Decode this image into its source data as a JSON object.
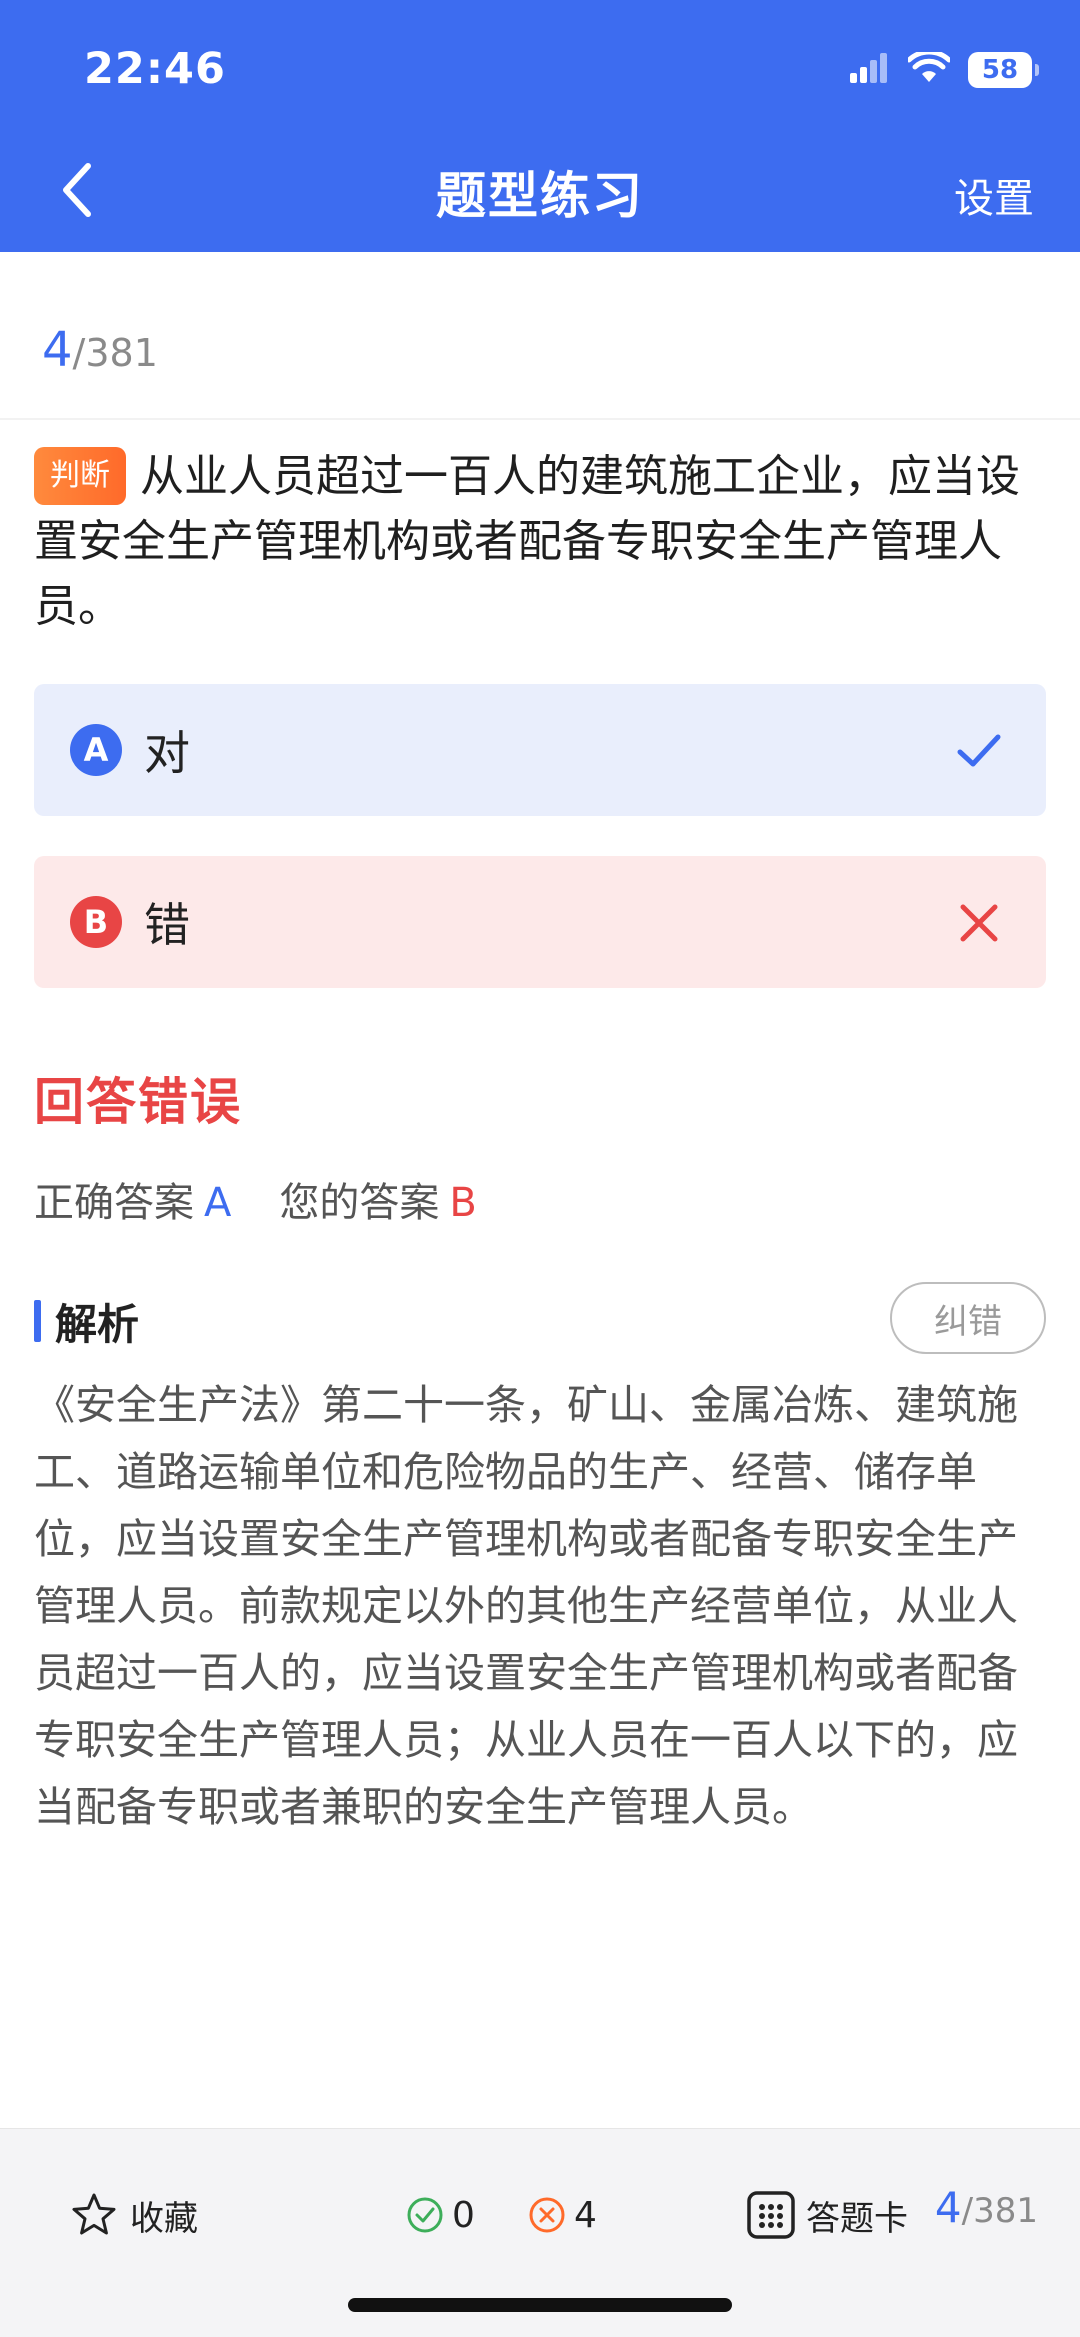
{
  "status_bar": {
    "time": "22:46",
    "battery": "58"
  },
  "header": {
    "title": "题型练习",
    "settings_label": "设置"
  },
  "progress": {
    "current": "4",
    "total": "/381"
  },
  "question": {
    "type_tag": "判断",
    "text": "从业人员超过一百人的建筑施工企业，应当设置安全生产管理机构或者配备专职安全生产管理人员。"
  },
  "options": [
    {
      "letter": "A",
      "text": "对",
      "state": "correct"
    },
    {
      "letter": "B",
      "text": "错",
      "state": "wrong"
    }
  ],
  "result": {
    "title": "回答错误",
    "correct_label": "正确答案",
    "correct_value": "A",
    "yours_label": "您的答案",
    "yours_value": "B"
  },
  "analysis": {
    "label": "解析",
    "correct_button": "纠错",
    "text": "《安全生产法》第二十一条，矿山、金属冶炼、建筑施工、道路运输单位和危险物品的生产、经营、储存单位，应当设置安全生产管理机构或者配备专职安全生产管理人员。前款规定以外的其他生产经营单位，从业人员超过一百人的，应当设置安全生产管理机构或者配备专职安全生产管理人员；从业人员在一百人以下的，应当配备专职或者兼职的安全生产管理人员。"
  },
  "bottom_bar": {
    "favorite_label": "收藏",
    "right_count": "0",
    "wrong_count": "4",
    "answer_card_label": "答题卡",
    "progress_current": "4",
    "progress_total": "/381"
  },
  "colors": {
    "primary": "#3d6cf0",
    "error": "#e84545",
    "success": "#3dae5a",
    "warning": "#ff6a2a"
  },
  "icons": [
    "back-chevron-icon",
    "signal-icon",
    "wifi-icon",
    "battery-icon",
    "check-icon",
    "close-icon",
    "star-icon",
    "check-circle-icon",
    "x-circle-icon",
    "grid-icon"
  ]
}
